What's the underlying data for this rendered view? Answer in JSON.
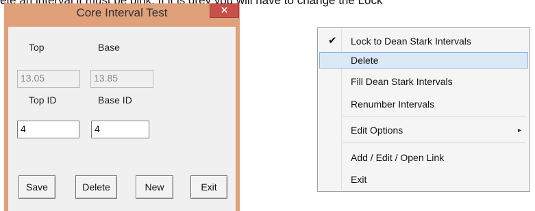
{
  "caption": "ete an interval it must be pink. If it is grey you will have to change the Lock",
  "dialog": {
    "title": "Core Interval Test",
    "close_glyph": "✕",
    "top_label": "Top",
    "base_label": "Base",
    "top_value": "13.05",
    "base_value": "13.85",
    "top_id_label": "Top ID",
    "base_id_label": "Base ID",
    "top_id_value": "4",
    "base_id_value": "4",
    "buttons": {
      "save": "Save",
      "delete": "Delete",
      "new": "New",
      "exit": "Exit"
    }
  },
  "context_menu": {
    "check_glyph": "✔",
    "submenu_arrow": "►",
    "items": [
      {
        "label": "Lock to Dean Stark Intervals",
        "checked": true
      },
      {
        "label": "Delete",
        "highlighted": true
      },
      {
        "label": "Fill Dean Stark Intervals"
      },
      {
        "label": "Renumber Intervals"
      },
      {
        "label": "Edit Options",
        "submenu": true
      },
      {
        "label": "Add / Edit / Open Link"
      },
      {
        "label": "Exit"
      }
    ]
  }
}
